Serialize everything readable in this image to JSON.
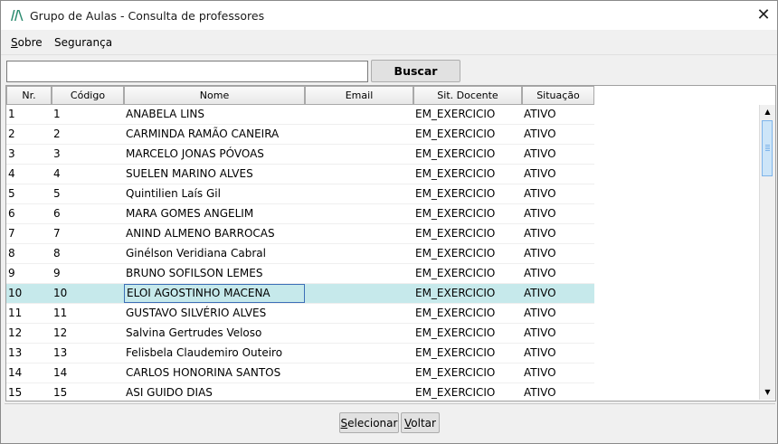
{
  "window": {
    "title": "Grupo de Aulas - Consulta de professores",
    "close_glyph": "✕"
  },
  "menu": [
    {
      "pre": "",
      "mnemonic": "S",
      "post": "obre"
    },
    {
      "pre": "Segurança",
      "mnemonic": "",
      "post": ""
    }
  ],
  "search": {
    "value": "",
    "placeholder": "",
    "button_label": "Buscar"
  },
  "grid": {
    "columns": [
      "Nr.",
      "Código",
      "Nome",
      "Email",
      "Sit. Docente",
      "Situação"
    ],
    "selected_row_index": 9,
    "rows": [
      [
        "1",
        "1",
        "ANABELA LINS",
        "",
        "EM_EXERCICIO",
        "ATIVO"
      ],
      [
        "2",
        "2",
        "CARMINDA RAMÃO CANEIRA",
        "",
        "EM_EXERCICIO",
        "ATIVO"
      ],
      [
        "3",
        "3",
        "MARCELO JONAS PÓVOAS",
        "",
        "EM_EXERCICIO",
        "ATIVO"
      ],
      [
        "4",
        "4",
        "SUELEN MARINO ALVES",
        "",
        "EM_EXERCICIO",
        "ATIVO"
      ],
      [
        "5",
        "5",
        "Quintilien Laís Gil",
        "",
        "EM_EXERCICIO",
        "ATIVO"
      ],
      [
        "6",
        "6",
        "MARA GOMES ANGELIM",
        "",
        "EM_EXERCICIO",
        "ATIVO"
      ],
      [
        "7",
        "7",
        "ANIND ALMENO BARROCAS",
        "",
        "EM_EXERCICIO",
        "ATIVO"
      ],
      [
        "8",
        "8",
        "Ginélson Veridiana Cabral",
        "",
        "EM_EXERCICIO",
        "ATIVO"
      ],
      [
        "9",
        "9",
        "BRUNO SOFILSON LEMES",
        "",
        "EM_EXERCICIO",
        "ATIVO"
      ],
      [
        "10",
        "10",
        "ELOI AGOSTINHO MACENA",
        "",
        "EM_EXERCICIO",
        "ATIVO"
      ],
      [
        "11",
        "11",
        "GUSTAVO SILVÉRIO ALVES",
        "",
        "EM_EXERCICIO",
        "ATIVO"
      ],
      [
        "12",
        "12",
        "Salvina Gertrudes Veloso",
        "",
        "EM_EXERCICIO",
        "ATIVO"
      ],
      [
        "13",
        "13",
        "Felisbela Claudemiro Outeiro",
        "",
        "EM_EXERCICIO",
        "ATIVO"
      ],
      [
        "14",
        "14",
        "CARLOS HONORINA SANTOS",
        "",
        "EM_EXERCICIO",
        "ATIVO"
      ],
      [
        "15",
        "15",
        "ASI GUIDO DIAS",
        "",
        "EM_EXERCICIO",
        "ATIVO"
      ]
    ]
  },
  "scrollbar": {
    "up_glyph": "▲",
    "down_glyph": "▼"
  },
  "footer": {
    "select_button": {
      "mnemonic": "S",
      "rest": "elecionar"
    },
    "back_button": {
      "mnemonic": "V",
      "rest": "oltar"
    }
  }
}
